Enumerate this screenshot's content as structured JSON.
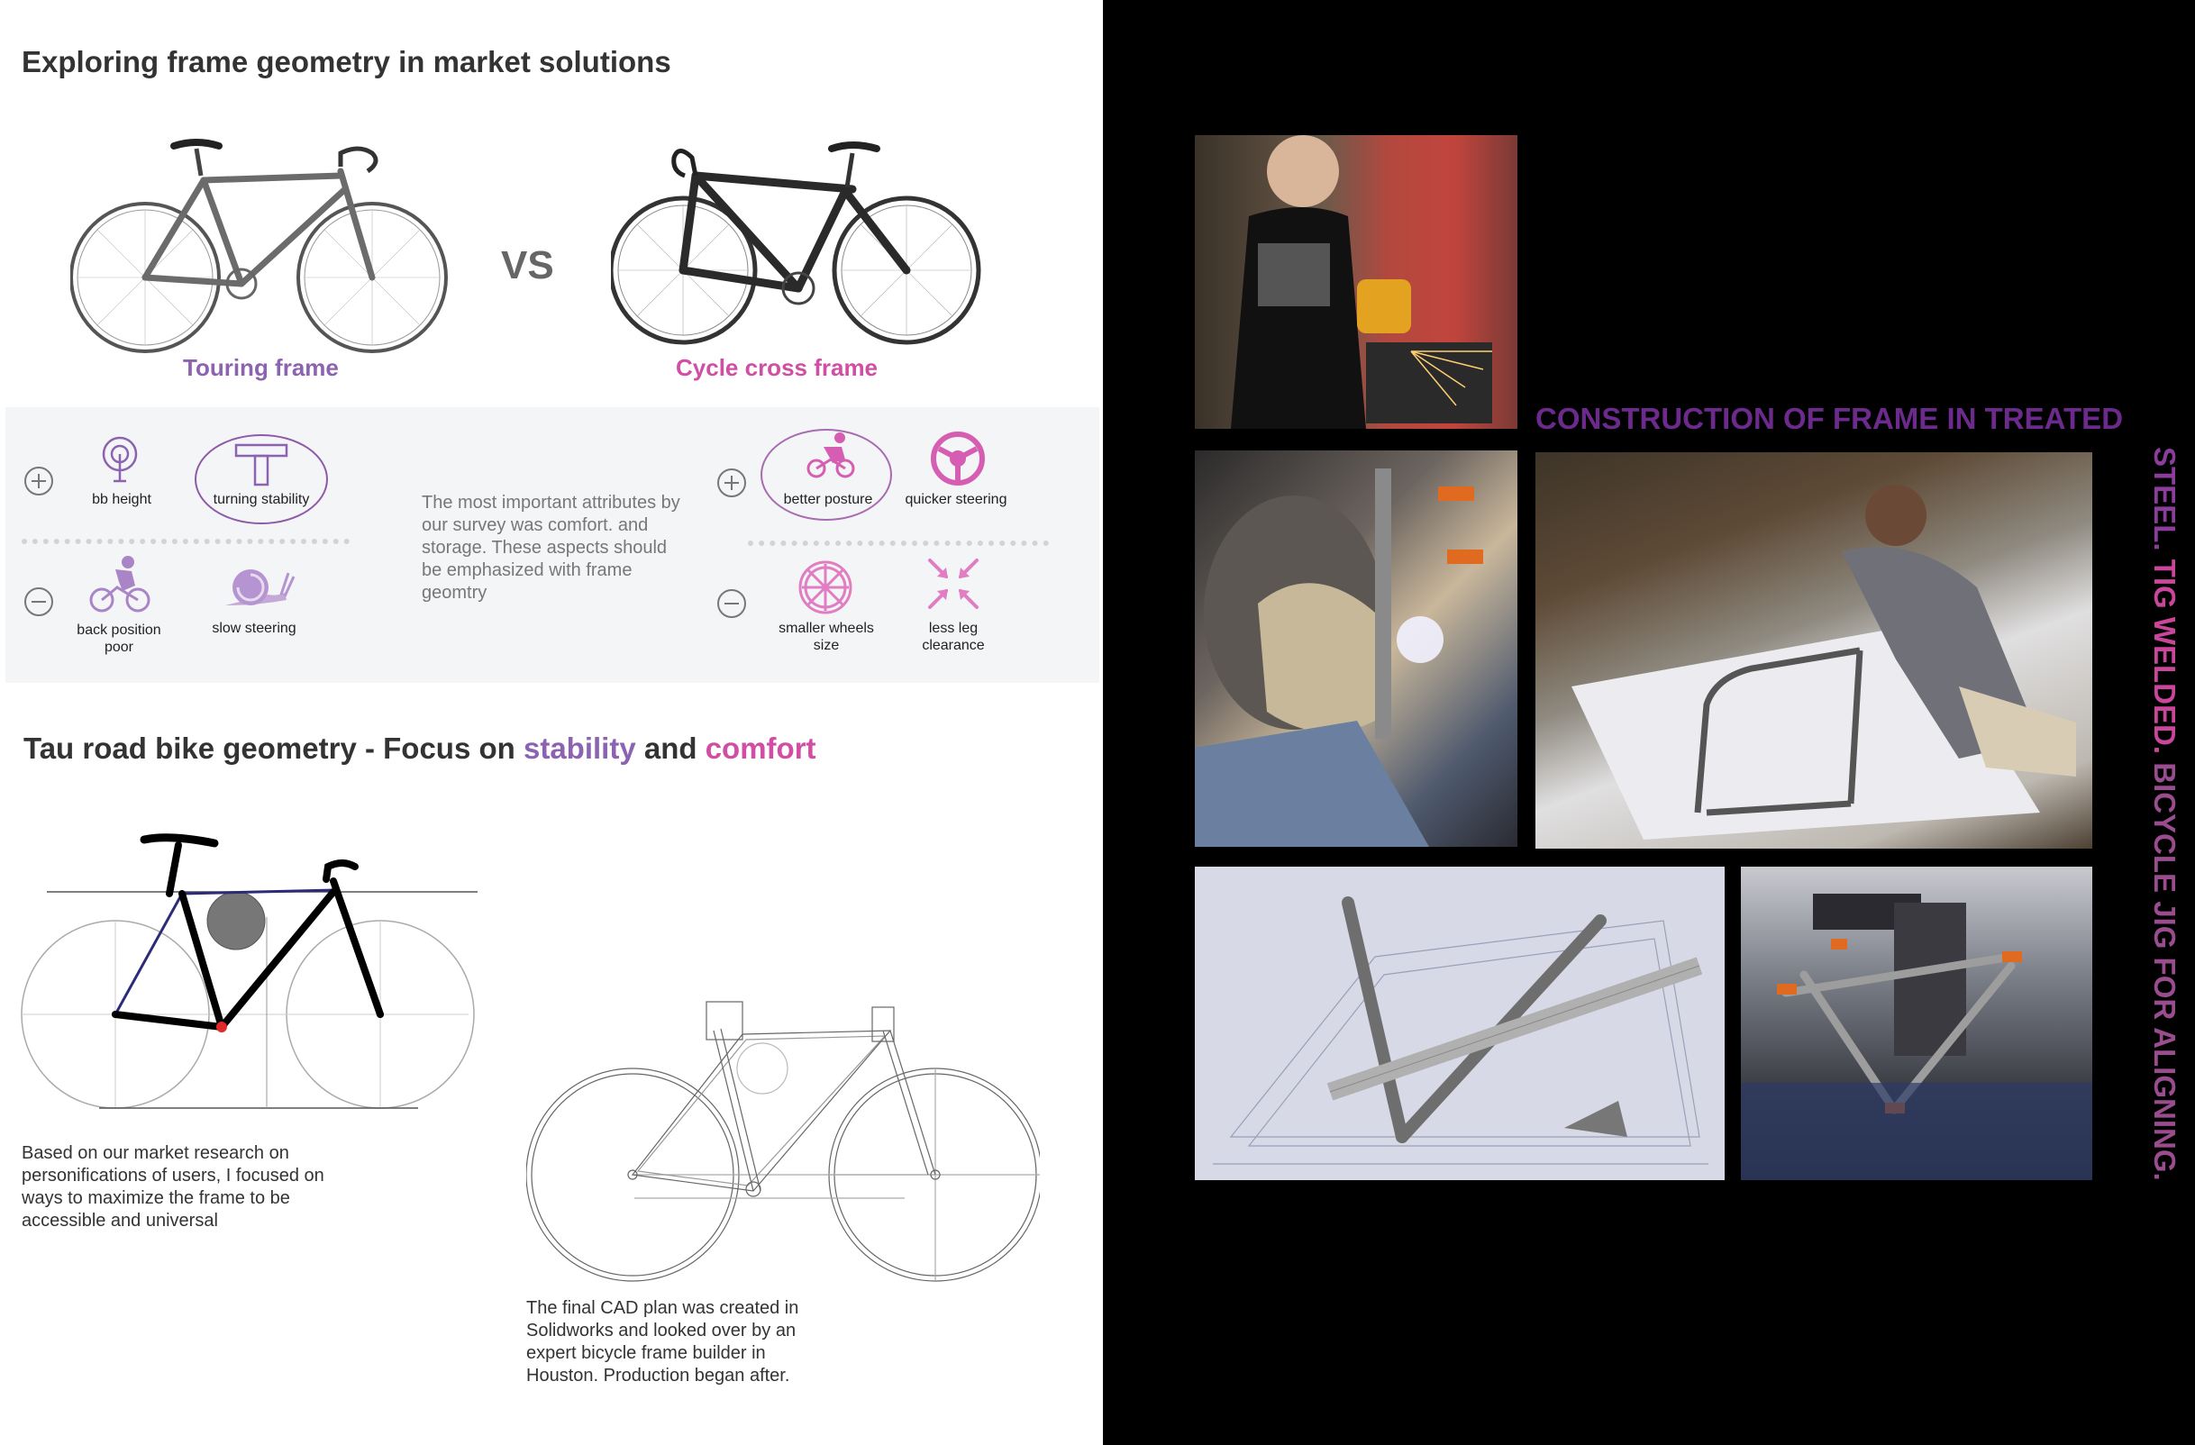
{
  "left": {
    "heading": "Exploring frame geometry in market solutions",
    "vs": "VS",
    "touring_caption": "Touring frame",
    "cyclecross_caption": "Cycle cross frame",
    "attributes": {
      "left_plus": [
        {
          "label": "bb height",
          "icon": "bb-height-icon"
        },
        {
          "label": "turning stability",
          "icon": "t-icon"
        }
      ],
      "left_minus": [
        {
          "label": "back position poor",
          "icon": "cyclist-icon"
        },
        {
          "label": "slow steering",
          "icon": "snail-icon"
        }
      ],
      "right_plus": [
        {
          "label": "better posture",
          "icon": "cyclist-icon"
        },
        {
          "label": "quicker steering",
          "icon": "steering-wheel-icon"
        }
      ],
      "right_minus": [
        {
          "label": "smaller wheels size",
          "icon": "wheel-icon"
        },
        {
          "label": "less leg clearance",
          "icon": "compress-arrows-icon"
        }
      ],
      "summary": "The most important attributes by our survey was comfort. and storage. These aspects should be emphasized with frame geomtry"
    },
    "geometry_heading": {
      "prefix": "Tau road bike geometry - Focus on ",
      "word1": "stability",
      "middle": " and ",
      "word2": "comfort"
    },
    "research_text": "Based on our market research on personifications of users, I focused on ways to maximize the frame to be accessible and universal",
    "cad_text": "The final CAD plan was created in Solidworks and looked over by an expert bicycle frame builder in Houston. Production began after."
  },
  "right": {
    "construction_line1": "CONSTRUCTION OF FRAME IN TREATED",
    "construction_line2_a": "STEEL. ",
    "construction_line2_b": "TIG WELDED. ",
    "construction_line2_c": "BICYCLE JIG FOR ALIGNING."
  },
  "colors": {
    "purple": "#8c63b0",
    "pink": "#d04ea3",
    "dark_purple": "#6c2a8c"
  }
}
